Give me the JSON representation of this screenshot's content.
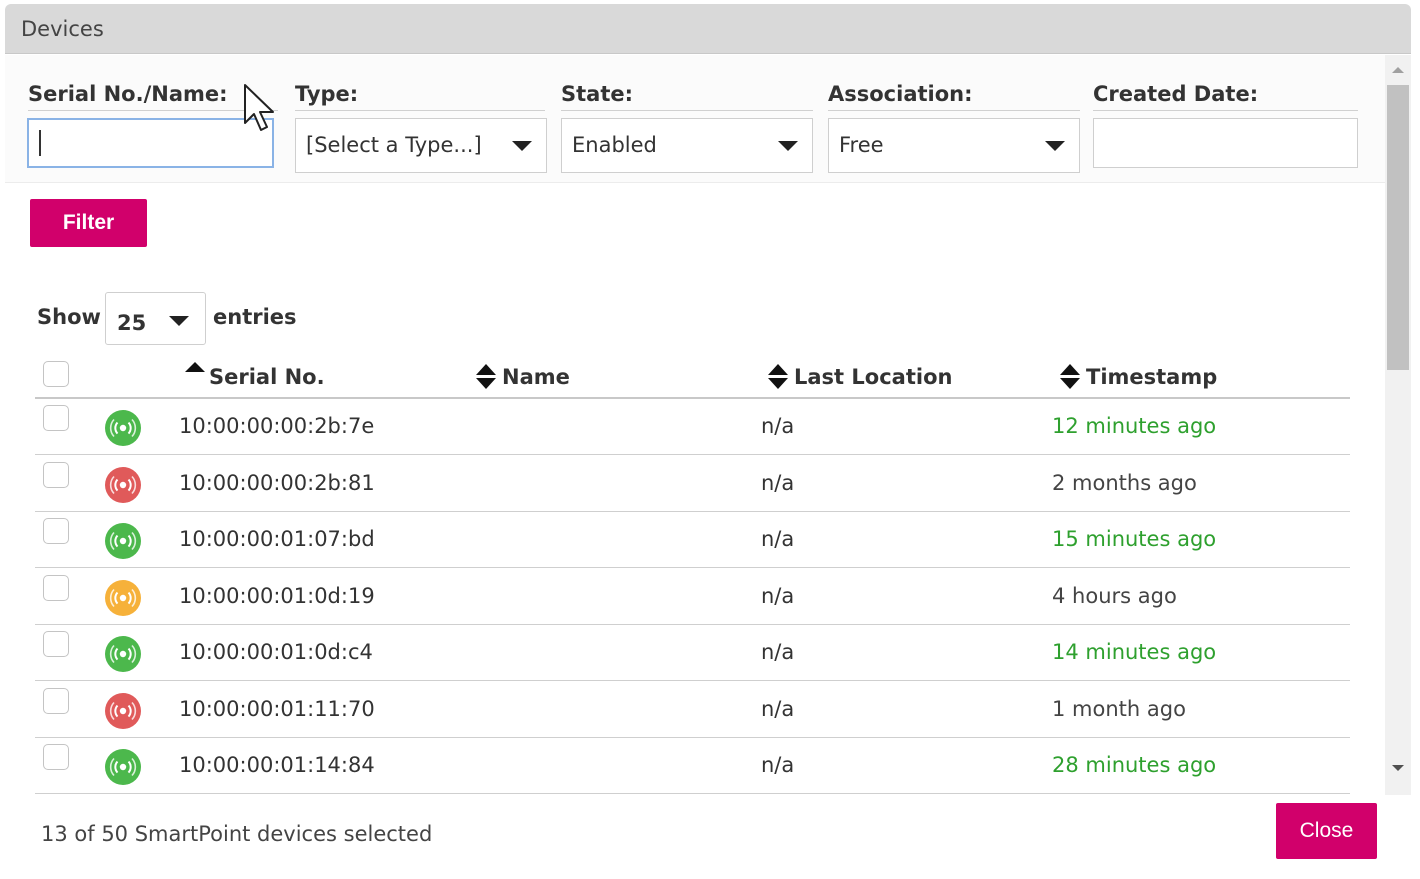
{
  "dialog": {
    "title": "Devices"
  },
  "filters": {
    "serial_label": "Serial No./Name:",
    "serial_value": "",
    "type_label": "Type:",
    "type_value": "[Select a Type...]",
    "state_label": "State:",
    "state_value": "Enabled",
    "association_label": "Association:",
    "association_value": "Free",
    "created_label": "Created Date:",
    "created_value": "",
    "filter_button": "Filter"
  },
  "table": {
    "show_label": "Show",
    "page_size": "25",
    "entries_label": "entries",
    "columns": {
      "serial": "Serial No.",
      "name": "Name",
      "last_location": "Last Location",
      "timestamp": "Timestamp"
    },
    "rows": [
      {
        "status": "green",
        "serial": "10:00:00:00:2b:7e",
        "name": "",
        "location": "n/a",
        "timestamp": "12 minutes ago",
        "recent": true
      },
      {
        "status": "red",
        "serial": "10:00:00:00:2b:81",
        "name": "",
        "location": "n/a",
        "timestamp": "2 months ago",
        "recent": false
      },
      {
        "status": "green",
        "serial": "10:00:00:01:07:bd",
        "name": "",
        "location": "n/a",
        "timestamp": "15 minutes ago",
        "recent": true
      },
      {
        "status": "orange",
        "serial": "10:00:00:01:0d:19",
        "name": "",
        "location": "n/a",
        "timestamp": "4 hours ago",
        "recent": false
      },
      {
        "status": "green",
        "serial": "10:00:00:01:0d:c4",
        "name": "",
        "location": "n/a",
        "timestamp": "14 minutes ago",
        "recent": true
      },
      {
        "status": "red",
        "serial": "10:00:00:01:11:70",
        "name": "",
        "location": "n/a",
        "timestamp": "1 month ago",
        "recent": false
      },
      {
        "status": "green",
        "serial": "10:00:00:01:14:84",
        "name": "",
        "location": "n/a",
        "timestamp": "28 minutes ago",
        "recent": true
      }
    ]
  },
  "footer": {
    "selection_text": "13 of 50 SmartPoint devices selected",
    "close_button": "Close"
  },
  "colors": {
    "accent": "#d1006b",
    "status_green": "#4cb84c",
    "status_red": "#e05a5a",
    "status_orange": "#f6b13a",
    "recent_text": "#2ea02e"
  },
  "icons": {
    "status": "signal-broadcast-icon",
    "sort_asc": "sort-up-icon",
    "sort_both": "sort-both-icon",
    "dropdown": "chevron-down-icon"
  }
}
